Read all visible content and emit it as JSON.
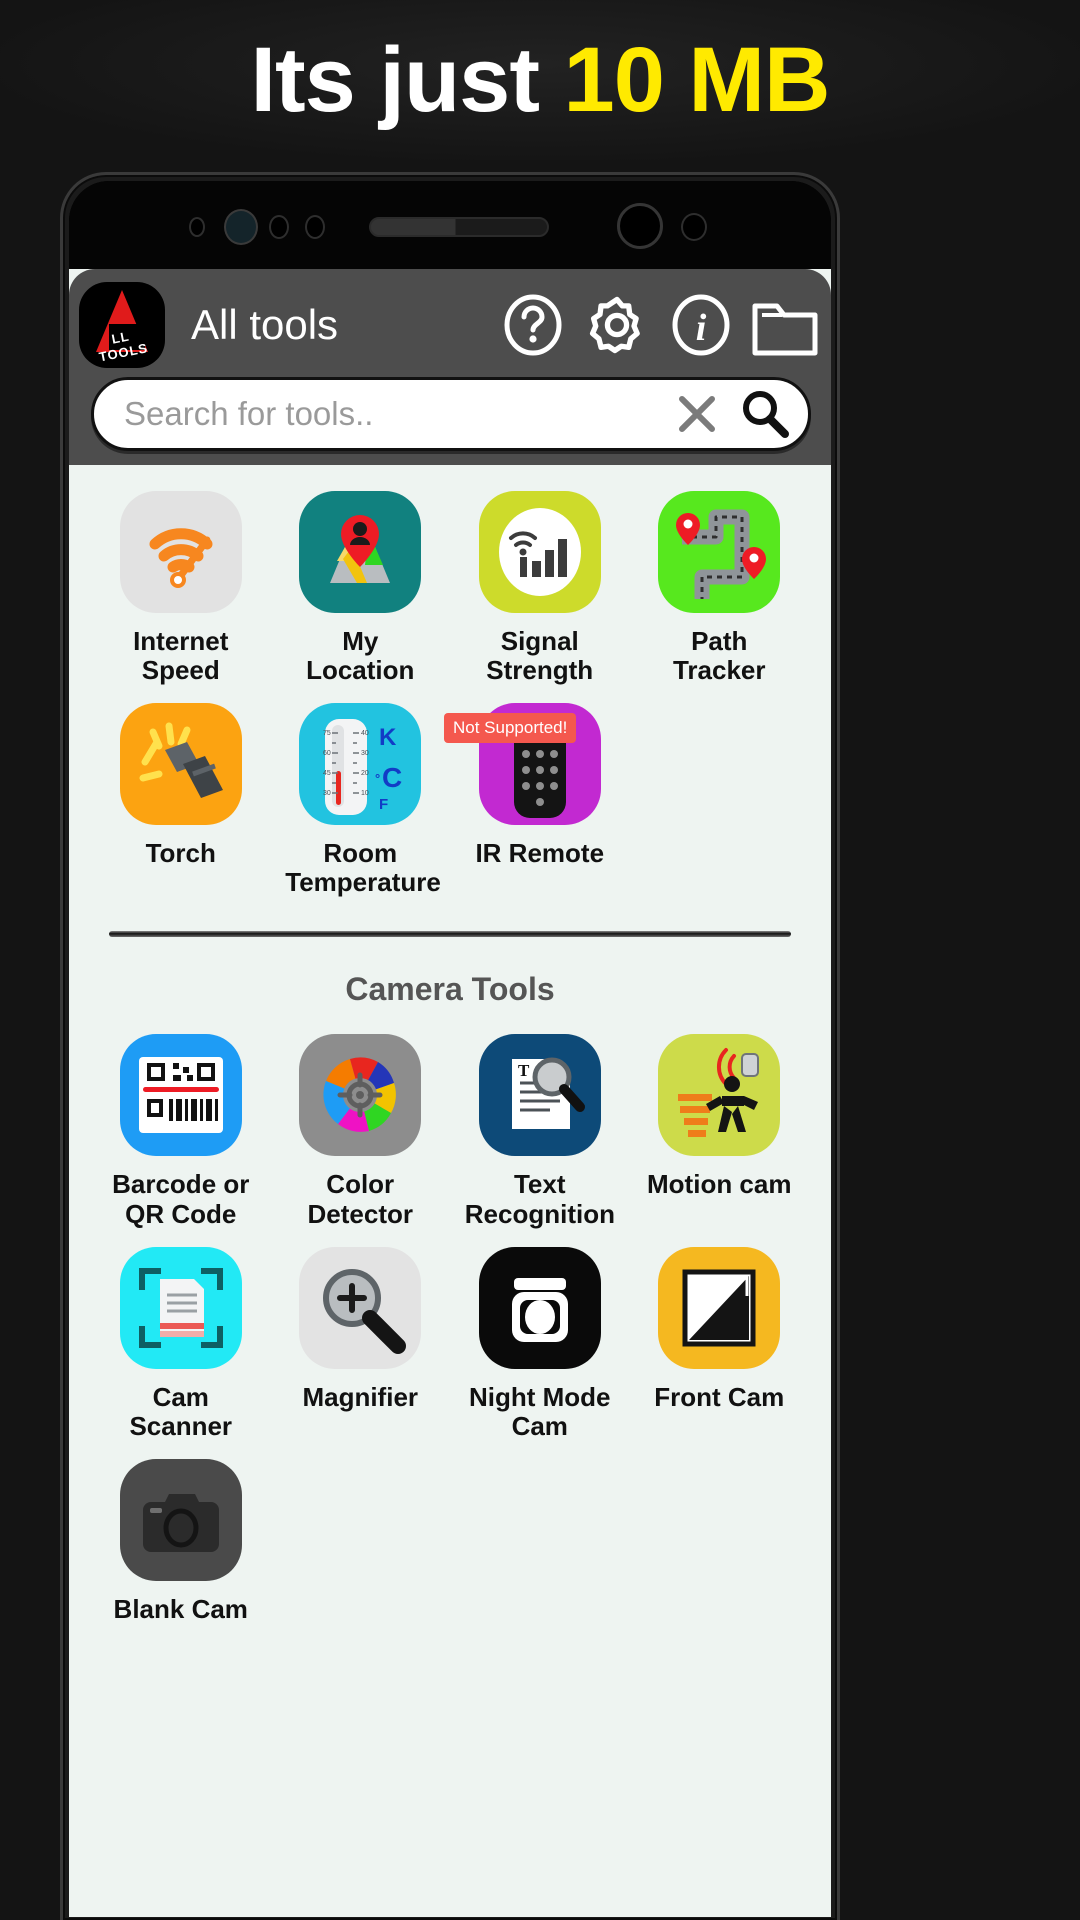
{
  "promo": {
    "text_plain": "Its just ",
    "text_accent": "10 MB",
    "accent_color": "#ffea00"
  },
  "phone": {
    "appbar": {
      "logo_word": "LL TOOLS",
      "title": "All tools",
      "icons": [
        {
          "name": "help-icon",
          "label": "Help"
        },
        {
          "name": "gear-icon",
          "label": "Settings"
        },
        {
          "name": "info-icon",
          "label": "Info"
        },
        {
          "name": "folder-icon",
          "label": "Files"
        }
      ]
    },
    "search": {
      "placeholder": "Search for tools..",
      "value": "",
      "clear_icon": "close-icon",
      "search_icon": "search-icon"
    },
    "sections": [
      {
        "id": "general-tools",
        "title": "",
        "tools": [
          {
            "label": "Internet Speed",
            "icon": "wifi-speed-icon",
            "bg": "#e2e2e2",
            "badge": null
          },
          {
            "label": "My Location",
            "icon": "map-pin-icon",
            "bg": "#11817f",
            "badge": null
          },
          {
            "label": "Signal Strength",
            "icon": "signal-bars-icon",
            "bg": "#cddb2b",
            "badge": null
          },
          {
            "label": "Path Tracker",
            "icon": "route-map-icon",
            "bg": "#57e81e",
            "badge": null
          },
          {
            "label": "Torch",
            "icon": "flashlight-icon",
            "bg": "#fca311",
            "badge": null
          },
          {
            "label": "Room Temperature",
            "icon": "thermometer-icon",
            "bg": "#22c3e0",
            "badge": null
          },
          {
            "label": "IR Remote",
            "icon": "remote-control-icon",
            "bg": "#c229d1",
            "badge": "Not Supported!"
          }
        ]
      },
      {
        "id": "camera-tools",
        "title": "Camera Tools",
        "tools": [
          {
            "label": "Barcode or QR Code",
            "icon": "barcode-qr-icon",
            "bg": "#1e9cf5",
            "badge": null
          },
          {
            "label": "Color Detector",
            "icon": "color-wheel-icon",
            "bg": "#8d8d8d",
            "badge": null
          },
          {
            "label": "Text Recognition",
            "icon": "text-scan-icon",
            "bg": "#0d4a78",
            "badge": null
          },
          {
            "label": "Motion cam",
            "icon": "motion-sensor-icon",
            "bg": "#cddb4a",
            "badge": null
          },
          {
            "label": "Cam Scanner",
            "icon": "doc-scan-icon",
            "bg": "#22e9f5",
            "badge": null
          },
          {
            "label": "Magnifier",
            "icon": "magnifier-icon",
            "bg": "#e3e3e3",
            "badge": null
          },
          {
            "label": "Night Mode Cam",
            "icon": "night-cam-icon",
            "bg": "#0a0a0a",
            "badge": null
          },
          {
            "label": "Front Cam",
            "icon": "front-cam-icon",
            "bg": "#f5b820",
            "badge": null
          },
          {
            "label": "Blank Cam",
            "icon": "blank-cam-icon",
            "bg": "#4a4a4a",
            "badge": null
          }
        ]
      }
    ]
  }
}
